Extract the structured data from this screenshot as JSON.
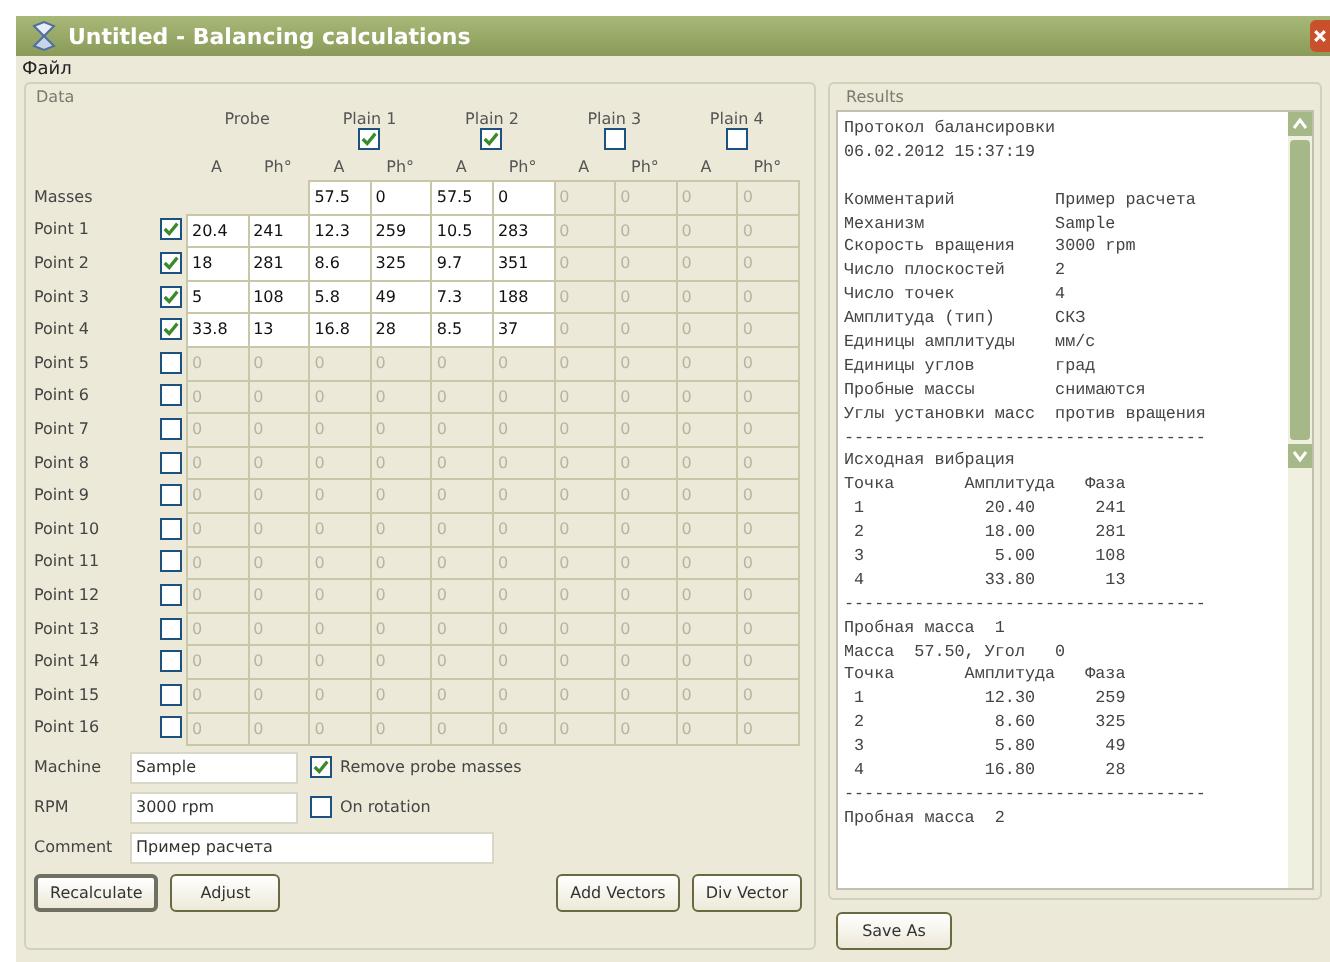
{
  "window": {
    "title": "Untitled - Balancing calculations"
  },
  "menu": [
    "Файл"
  ],
  "data_panel": {
    "title": "Data",
    "groups": [
      {
        "label": "Probe"
      },
      {
        "label": "Plain 1",
        "checked": true
      },
      {
        "label": "Plain 2",
        "checked": true
      },
      {
        "label": "Plain 3",
        "checked": false
      },
      {
        "label": "Plain 4",
        "checked": false
      }
    ],
    "subheaders": [
      "A",
      "Ph°",
      "A",
      "Ph°",
      "A",
      "Ph°",
      "A",
      "Ph°",
      "A",
      "Ph°"
    ],
    "masses": {
      "label": "Masses",
      "values": [
        "57.5",
        "0",
        "57.5",
        "0",
        "0",
        "0",
        "0",
        "0"
      ]
    },
    "points": [
      {
        "label": "Point 1",
        "checked": true,
        "values": [
          "20.4",
          "241",
          "12.3",
          "259",
          "10.5",
          "283",
          "0",
          "0",
          "0",
          "0"
        ]
      },
      {
        "label": "Point 2",
        "checked": true,
        "values": [
          "18",
          "281",
          "8.6",
          "325",
          "9.7",
          "351",
          "0",
          "0",
          "0",
          "0"
        ]
      },
      {
        "label": "Point 3",
        "checked": true,
        "values": [
          "5",
          "108",
          "5.8",
          "49",
          "7.3",
          "188",
          "0",
          "0",
          "0",
          "0"
        ]
      },
      {
        "label": "Point 4",
        "checked": true,
        "values": [
          "33.8",
          "13",
          "16.8",
          "28",
          "8.5",
          "37",
          "0",
          "0",
          "0",
          "0"
        ]
      },
      {
        "label": "Point 5",
        "checked": false,
        "values": [
          "0",
          "0",
          "0",
          "0",
          "0",
          "0",
          "0",
          "0",
          "0",
          "0"
        ]
      },
      {
        "label": "Point 6",
        "checked": false,
        "values": [
          "0",
          "0",
          "0",
          "0",
          "0",
          "0",
          "0",
          "0",
          "0",
          "0"
        ]
      },
      {
        "label": "Point 7",
        "checked": false,
        "values": [
          "0",
          "0",
          "0",
          "0",
          "0",
          "0",
          "0",
          "0",
          "0",
          "0"
        ]
      },
      {
        "label": "Point 8",
        "checked": false,
        "values": [
          "0",
          "0",
          "0",
          "0",
          "0",
          "0",
          "0",
          "0",
          "0",
          "0"
        ]
      },
      {
        "label": "Point 9",
        "checked": false,
        "values": [
          "0",
          "0",
          "0",
          "0",
          "0",
          "0",
          "0",
          "0",
          "0",
          "0"
        ]
      },
      {
        "label": "Point 10",
        "checked": false,
        "values": [
          "0",
          "0",
          "0",
          "0",
          "0",
          "0",
          "0",
          "0",
          "0",
          "0"
        ]
      },
      {
        "label": "Point 11",
        "checked": false,
        "values": [
          "0",
          "0",
          "0",
          "0",
          "0",
          "0",
          "0",
          "0",
          "0",
          "0"
        ]
      },
      {
        "label": "Point 12",
        "checked": false,
        "values": [
          "0",
          "0",
          "0",
          "0",
          "0",
          "0",
          "0",
          "0",
          "0",
          "0"
        ]
      },
      {
        "label": "Point 13",
        "checked": false,
        "values": [
          "0",
          "0",
          "0",
          "0",
          "0",
          "0",
          "0",
          "0",
          "0",
          "0"
        ]
      },
      {
        "label": "Point 14",
        "checked": false,
        "values": [
          "0",
          "0",
          "0",
          "0",
          "0",
          "0",
          "0",
          "0",
          "0",
          "0"
        ]
      },
      {
        "label": "Point 15",
        "checked": false,
        "values": [
          "0",
          "0",
          "0",
          "0",
          "0",
          "0",
          "0",
          "0",
          "0",
          "0"
        ]
      },
      {
        "label": "Point 16",
        "checked": false,
        "values": [
          "0",
          "0",
          "0",
          "0",
          "0",
          "0",
          "0",
          "0",
          "0",
          "0"
        ]
      }
    ],
    "fields": [
      {
        "label": "Machine",
        "value": "Sample",
        "option": {
          "label": "Remove probe masses",
          "checked": true
        }
      },
      {
        "label": "RPM",
        "value": "3000 rpm",
        "option": {
          "label": "On rotation",
          "checked": false
        }
      },
      {
        "label": "Comment",
        "value": "Пример расчета"
      }
    ],
    "buttons_left": [
      "Recalculate",
      "Adjust"
    ],
    "buttons_right": [
      "Add Vectors",
      "Div Vector"
    ]
  },
  "results_panel": {
    "title": "Results",
    "header_lines": [
      "Протокол балансировки",
      "06.02.2012 15:37:19"
    ],
    "lines": [
      "Комментарий          Пример расчета",
      "Механизм             Sample",
      "Скорость вращения    3000 rpm",
      "Число плоскостей     2",
      "Число точек          4",
      "Амплитуда (тип)      СКЗ",
      "Единицы амплитуды    мм/с",
      "Единицы углов        град",
      "Пробные массы        снимаются",
      "Углы установки масс  против вращения",
      "------------------------------------",
      "Исходная вибрация",
      "Точка       Амплитуда   Фаза",
      " 1            20.40      241",
      " 2            18.00      281",
      " 3             5.00      108",
      " 4            33.80       13",
      "------------------------------------",
      "Пробная масса  1",
      "Масса  57.50, Угол   0",
      "Точка       Амплитуда   Фаза",
      " 1            12.30      259",
      " 2             8.60      325",
      " 3             5.80       49",
      " 4            16.80       28",
      "------------------------------------",
      "Пробная масса  2"
    ],
    "button": "Save As"
  }
}
